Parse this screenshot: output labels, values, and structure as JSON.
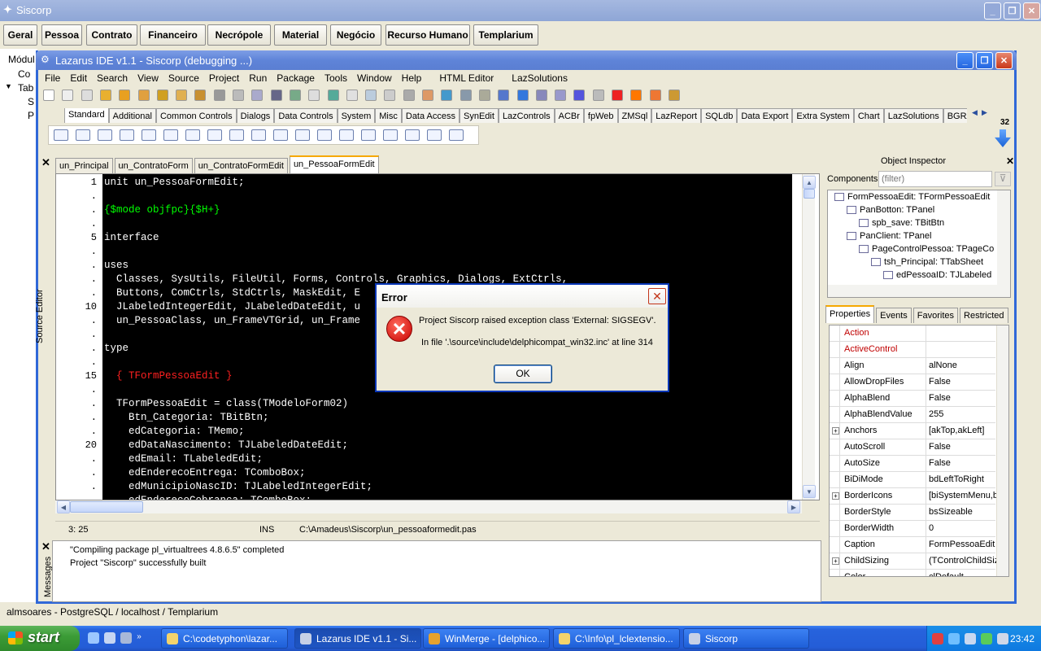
{
  "app": {
    "title": "Siscorp",
    "modules": [
      "Geral",
      "Pessoa",
      "Contrato",
      "Financeiro",
      "Necrópole",
      "Material",
      "Negócio",
      "Recurso Humano",
      "Templarium"
    ],
    "left_tree": [
      "Módul",
      "Co",
      "Tab",
      "S",
      "P"
    ],
    "status": "almsoares - PostgreSQL / localhost / Templarium"
  },
  "ide": {
    "title": "Lazarus IDE v1.1 - Siscorp (debugging ...)",
    "menu": [
      "File",
      "Edit",
      "Search",
      "View",
      "Source",
      "Project",
      "Run",
      "Package",
      "Tools",
      "Window",
      "Help",
      "HTML Editor",
      "LazSolutions"
    ],
    "palette_tabs": [
      "Standard",
      "Additional",
      "Common Controls",
      "Dialogs",
      "Data Controls",
      "System",
      "Misc",
      "Data Access",
      "SynEdit",
      "LazControls",
      "ACBr",
      "fpWeb",
      "ZMSql",
      "LazReport",
      "SQLdb",
      "Data Export",
      "Extra System",
      "Chart",
      "LazSolutions",
      "BGRA"
    ],
    "palette_count": "32",
    "editor_tabs": [
      "un_Principal",
      "un_ContratoForm",
      "un_ContratoFormEdit",
      "un_PessoaFormEdit"
    ],
    "source_editor_label": "Source Editor",
    "gutter": [
      "1",
      ".",
      ".",
      ".",
      "5",
      ".",
      ".",
      ".",
      ".",
      "10",
      ".",
      ".",
      ".",
      ".",
      "15",
      ".",
      ".",
      ".",
      ".",
      "20",
      ".",
      ".",
      "."
    ],
    "code_lines": [
      {
        "t": "unit un_PessoaFormEdit;",
        "c": "kw"
      },
      {
        "t": "",
        "c": "kw"
      },
      {
        "t": "{$mode objfpc}{$H+}",
        "c": "cm"
      },
      {
        "t": "",
        "c": "kw"
      },
      {
        "t": "interface",
        "c": "kw"
      },
      {
        "t": "",
        "c": "kw"
      },
      {
        "t": "uses",
        "c": "kw"
      },
      {
        "t": "  Classes, SysUtils, FileUtil, Forms, Controls, Graphics, Dialogs, ExtCtrls,",
        "c": "kw"
      },
      {
        "t": "  Buttons, ComCtrls, StdCtrls, MaskEdit, E",
        "c": "kw"
      },
      {
        "t": "  JLabeledIntegerEdit, JLabeledDateEdit, u",
        "c": "kw"
      },
      {
        "t": "  un_PessoaClass, un_FrameVTGrid, un_Frame",
        "c": "kw"
      },
      {
        "t": "",
        "c": "kw"
      },
      {
        "t": "type",
        "c": "kw"
      },
      {
        "t": "",
        "c": "kw"
      },
      {
        "t": "  { TFormPessoaEdit }",
        "c": "rd"
      },
      {
        "t": "",
        "c": "kw"
      },
      {
        "t": "  TFormPessoaEdit = class(TModeloForm02)",
        "c": "kw"
      },
      {
        "t": "    Btn_Categoria: TBitBtn;",
        "c": "kw"
      },
      {
        "t": "    edCategoria: TMemo;",
        "c": "kw"
      },
      {
        "t": "    edDataNascimento: TJLabeledDateEdit;",
        "c": "kw"
      },
      {
        "t": "    edEmail: TLabeledEdit;",
        "c": "kw"
      },
      {
        "t": "    edEnderecoEntrega: TComboBox;",
        "c": "kw"
      },
      {
        "t": "    edMunicipioNascID: TJLabeledIntegerEdit;",
        "c": "kw"
      },
      {
        "t": "    edEnderecoCobranca: TComboBox;",
        "c": "kw"
      }
    ],
    "status_bar": {
      "pos": "3: 25",
      "mode": "INS",
      "file": "C:\\Amadeus\\Siscorp\\un_pessoaformedit.pas"
    },
    "messages_label": "Messages",
    "messages": [
      "\"Compiling package pl_virtualtrees 4.8.6.5\" completed",
      "Project \"Siscorp\" successfully built"
    ]
  },
  "inspector": {
    "title": "Object Inspector",
    "components_label": "Components",
    "filter_placeholder": "(filter)",
    "tree": [
      {
        "label": "FormPessoaEdit: TFormPessoaEdit",
        "lvl": 0
      },
      {
        "label": "PanBotton: TPanel",
        "lvl": 1
      },
      {
        "label": "spb_save: TBitBtn",
        "lvl": 2
      },
      {
        "label": "PanClient: TPanel",
        "lvl": 1
      },
      {
        "label": "PageControlPessoa: TPageCo",
        "lvl": 2
      },
      {
        "label": "tsh_Principal: TTabSheet",
        "lvl": 3
      },
      {
        "label": "edPessoaID: TJLabeled",
        "lvl": 4
      }
    ],
    "tabs": [
      "Properties",
      "Events",
      "Favorites",
      "Restricted"
    ],
    "props": [
      {
        "n": "Action",
        "v": "",
        "red": true,
        "x": false
      },
      {
        "n": "ActiveControl",
        "v": "",
        "red": true,
        "x": false
      },
      {
        "n": "Align",
        "v": "alNone",
        "red": false,
        "x": false
      },
      {
        "n": "AllowDropFiles",
        "v": "False",
        "red": false,
        "x": false
      },
      {
        "n": "AlphaBlend",
        "v": "False",
        "red": false,
        "x": false
      },
      {
        "n": "AlphaBlendValue",
        "v": "255",
        "red": false,
        "x": false
      },
      {
        "n": "Anchors",
        "v": "[akTop,akLeft]",
        "red": false,
        "x": true
      },
      {
        "n": "AutoScroll",
        "v": "False",
        "red": false,
        "x": false
      },
      {
        "n": "AutoSize",
        "v": "False",
        "red": false,
        "x": false
      },
      {
        "n": "BiDiMode",
        "v": "bdLeftToRight",
        "red": false,
        "x": false
      },
      {
        "n": "BorderIcons",
        "v": "[biSystemMenu,bi",
        "red": false,
        "x": true
      },
      {
        "n": "BorderStyle",
        "v": "bsSizeable",
        "red": false,
        "x": false
      },
      {
        "n": "BorderWidth",
        "v": "0",
        "red": false,
        "x": false
      },
      {
        "n": "Caption",
        "v": "FormPessoaEdit",
        "red": false,
        "x": false
      },
      {
        "n": "ChildSizing",
        "v": "(TControlChildSizin",
        "red": false,
        "x": true
      },
      {
        "n": "Color",
        "v": "clDefault",
        "red": false,
        "x": false
      }
    ]
  },
  "dialog": {
    "title": "Error",
    "line1": "Project Siscorp raised exception class 'External: SIGSEGV'.",
    "line2": "In file '.\\source\\include\\delphicompat_win32.inc' at line 314",
    "ok": "OK"
  },
  "taskbar": {
    "start": "start",
    "items": [
      "C:\\codetyphon\\lazar...",
      "Lazarus IDE v1.1 - Si...",
      "WinMerge - [delphico...",
      "C:\\Info\\pl_lclextensio...",
      "Siscorp"
    ],
    "clock": "23:42"
  }
}
